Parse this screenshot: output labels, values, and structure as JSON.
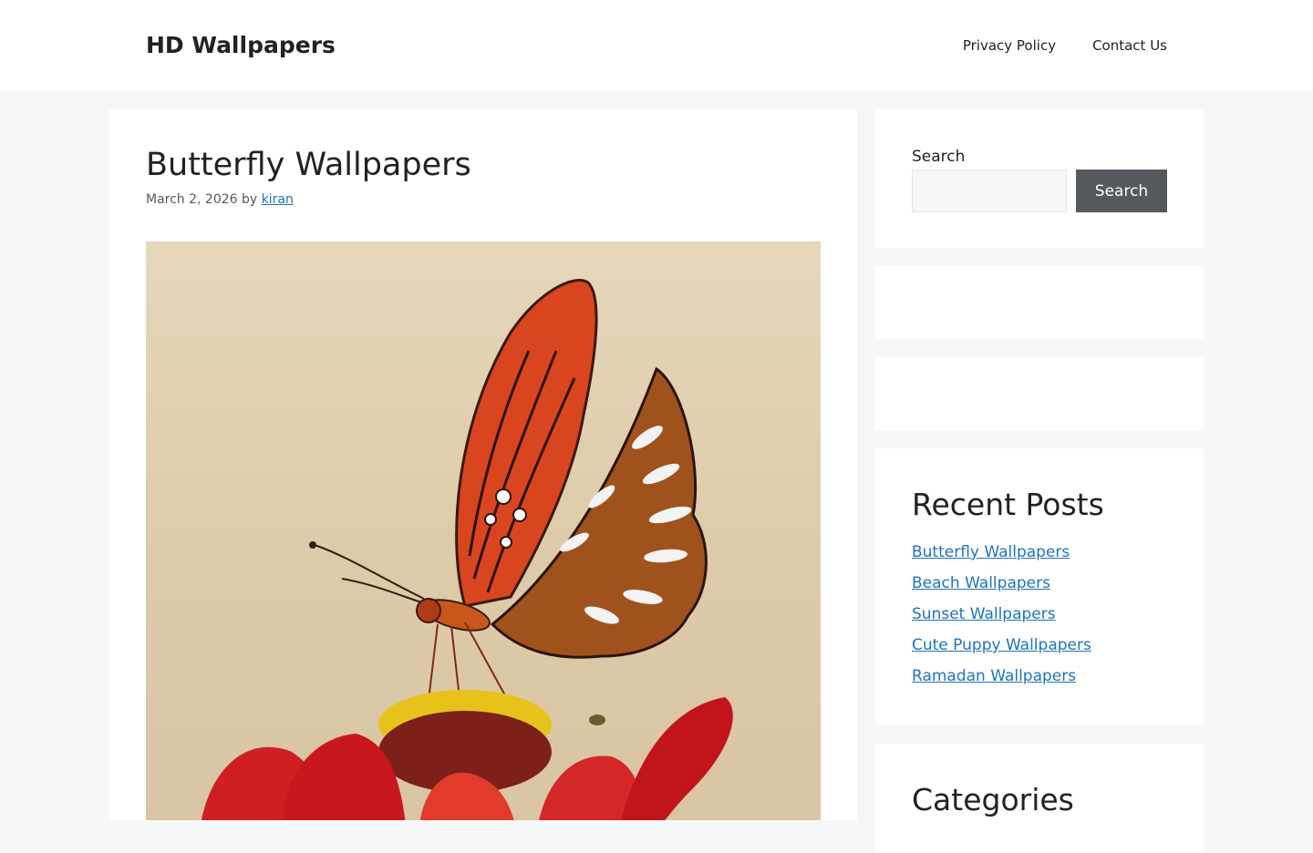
{
  "site": {
    "title": "HD Wallpapers"
  },
  "nav": {
    "items": [
      {
        "label": "Privacy Policy"
      },
      {
        "label": "Contact Us"
      }
    ]
  },
  "post": {
    "title": "Butterfly Wallpapers",
    "date": "March 2, 2026",
    "by": "by",
    "author": "kiran"
  },
  "sidebar": {
    "search": {
      "label": "Search",
      "placeholder": "",
      "button": "Search"
    },
    "recent": {
      "title": "Recent Posts",
      "items": [
        {
          "label": "Butterfly Wallpapers"
        },
        {
          "label": "Beach Wallpapers"
        },
        {
          "label": "Sunset Wallpapers"
        },
        {
          "label": "Cute Puppy Wallpapers"
        },
        {
          "label": "Ramadan Wallpapers"
        }
      ]
    },
    "categories": {
      "title": "Categories"
    }
  },
  "colors": {
    "link": "#1e73be",
    "button": "#55585d",
    "page_bg": "#f6f7f8"
  }
}
